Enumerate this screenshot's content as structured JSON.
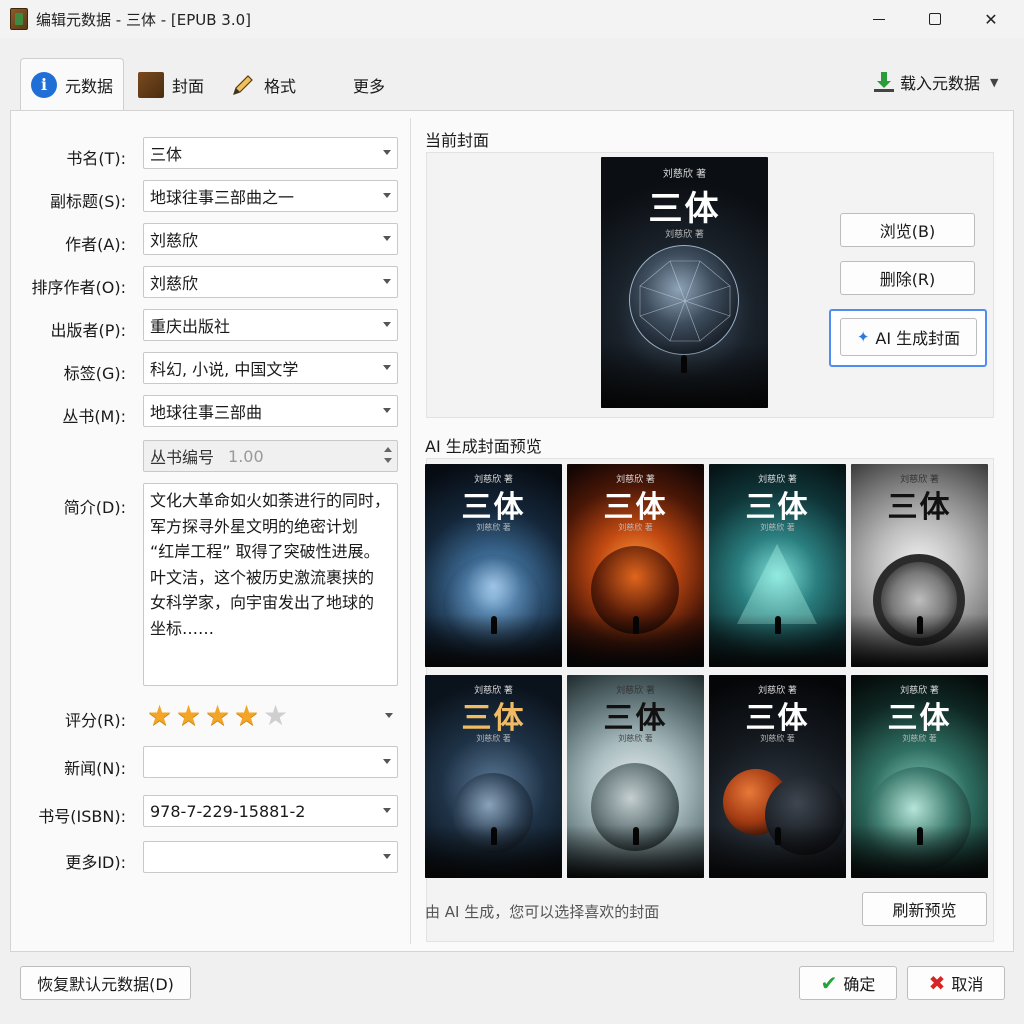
{
  "window": {
    "title": "编辑元数据 - 三体 - [EPUB 3.0]"
  },
  "tabs": [
    {
      "label": "元数据",
      "icon": "info-icon"
    },
    {
      "label": "封面",
      "icon": "book-cover-icon"
    },
    {
      "label": "格式",
      "icon": "pencil-icon"
    },
    {
      "label": "更多",
      "icon": "grid-icon"
    }
  ],
  "toolbar": {
    "load_metadata_label": "载入元数据"
  },
  "form": {
    "title_label": "书名(T):",
    "title_value": "三体",
    "subtitle_label": "副标题(S):",
    "subtitle_value": "地球往事三部曲之一",
    "author_label": "作者(A):",
    "author_value": "刘慈欣",
    "sort_author_label": "排序作者(O):",
    "sort_author_value": "刘慈欣",
    "publisher_label": "出版者(P):",
    "publisher_value": "重庆出版社",
    "tags_label": "标签(G):",
    "tags_value": "科幻, 小说, 中国文学",
    "series_label": "丛书(M):",
    "series_value": "地球往事三部曲",
    "series_index_label": "丛书编号",
    "series_index_value": "1.00",
    "summary_label": "简介(D):",
    "summary_value": "文化大革命如火如荼进行的同时，\n军方探寻外星文明的绝密计划\n“红岸工程” 取得了突破性进展。\n叶文洁，这个被历史激流裹挟的\n女科学家，向宇宙发出了地球的\n坐标……",
    "rating_label": "评分(R):",
    "rating": 4,
    "rating_max": 5,
    "news_label": "新闻(N):",
    "news_value": "",
    "isbn_label": "书号(ISBN):",
    "isbn_value": "978-7-229-15881-2",
    "more_id_label": "更多ID):",
    "more_id_value": ""
  },
  "cover": {
    "section_title": "当前封面",
    "book_author": "刘慈欣 著",
    "book_title": "三体",
    "browse_label": "浏览(B)",
    "delete_label": "删除(R)",
    "ai_generate_label": "AI 生成封面"
  },
  "preview": {
    "section_title": "AI 生成封面预览",
    "hint": "由 AI 生成，您可以选择喜欢的封面",
    "refresh_label": "刷新预览",
    "covers": [
      {
        "author": "刘慈欣 著",
        "title": "三体",
        "sub": "刘慈欣 著"
      },
      {
        "author": "刘慈欣 著",
        "title": "三体",
        "sub": "刘慈欣 著"
      },
      {
        "author": "刘慈欣 著",
        "title": "三体",
        "sub": "刘慈欣 著"
      },
      {
        "author": "刘慈欣 著",
        "title": "三体",
        "sub": ""
      },
      {
        "author": "刘慈欣 著",
        "title": "三体",
        "sub": "刘慈欣 著"
      },
      {
        "author": "刘慈欣 著",
        "title": "三体",
        "sub": "刘慈欣 著"
      },
      {
        "author": "刘慈欣 著",
        "title": "三体",
        "sub": "刘慈欣 著"
      },
      {
        "author": "刘慈欣 著",
        "title": "三体",
        "sub": "刘慈欣 著"
      }
    ]
  },
  "footer": {
    "restore_label": "恢复默认元数据(D)",
    "ok_label": "确定",
    "cancel_label": "取消"
  },
  "colors": {
    "accent": "#4f8ef0",
    "star": "#f2a526",
    "ok": "#23a33a",
    "cancel": "#d92424"
  }
}
